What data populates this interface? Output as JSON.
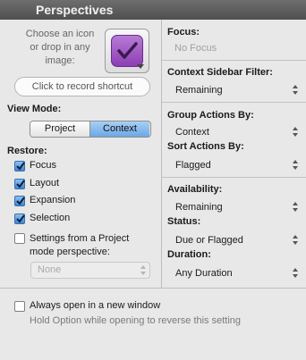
{
  "window": {
    "title": "Perspectives"
  },
  "icon_area": {
    "prompt": "Choose an icon or drop in any image:",
    "prompt_lines": [
      "Choose an icon",
      "or drop in any",
      "image:"
    ],
    "icon": "checkmark-app-icon"
  },
  "shortcut": {
    "label": "Click to record shortcut"
  },
  "view_mode": {
    "label": "View Mode:",
    "options": [
      "Project",
      "Context"
    ],
    "selected": "Context"
  },
  "restore": {
    "label": "Restore:",
    "items": [
      {
        "label": "Focus",
        "checked": true
      },
      {
        "label": "Layout",
        "checked": true
      },
      {
        "label": "Expansion",
        "checked": true
      },
      {
        "label": "Selection",
        "checked": true
      }
    ],
    "settings_from_project": {
      "line1": "Settings from a Project",
      "line2": "mode perspective:",
      "checked": false
    },
    "perspective_popup": {
      "value": "None",
      "enabled": false
    }
  },
  "right": {
    "focus": {
      "label": "Focus:",
      "value": "No Focus"
    },
    "context_sidebar_filter": {
      "label": "Context Sidebar Filter:",
      "value": "Remaining"
    },
    "group_actions_by": {
      "label": "Group Actions By:",
      "value": "Context"
    },
    "sort_actions_by": {
      "label": "Sort Actions By:",
      "value": "Flagged"
    },
    "availability": {
      "label": "Availability:",
      "value": "Remaining"
    },
    "status": {
      "label": "Status:",
      "value": "Due or Flagged"
    },
    "duration": {
      "label": "Duration:",
      "value": "Any Duration"
    }
  },
  "bottom": {
    "always_open": {
      "label": "Always open in a new window",
      "checked": false
    },
    "hint": "Hold Option while opening to reverse this setting"
  },
  "colors": {
    "selected_segment": "#6ca7e6",
    "checkbox_checked": "#3f86d6"
  }
}
